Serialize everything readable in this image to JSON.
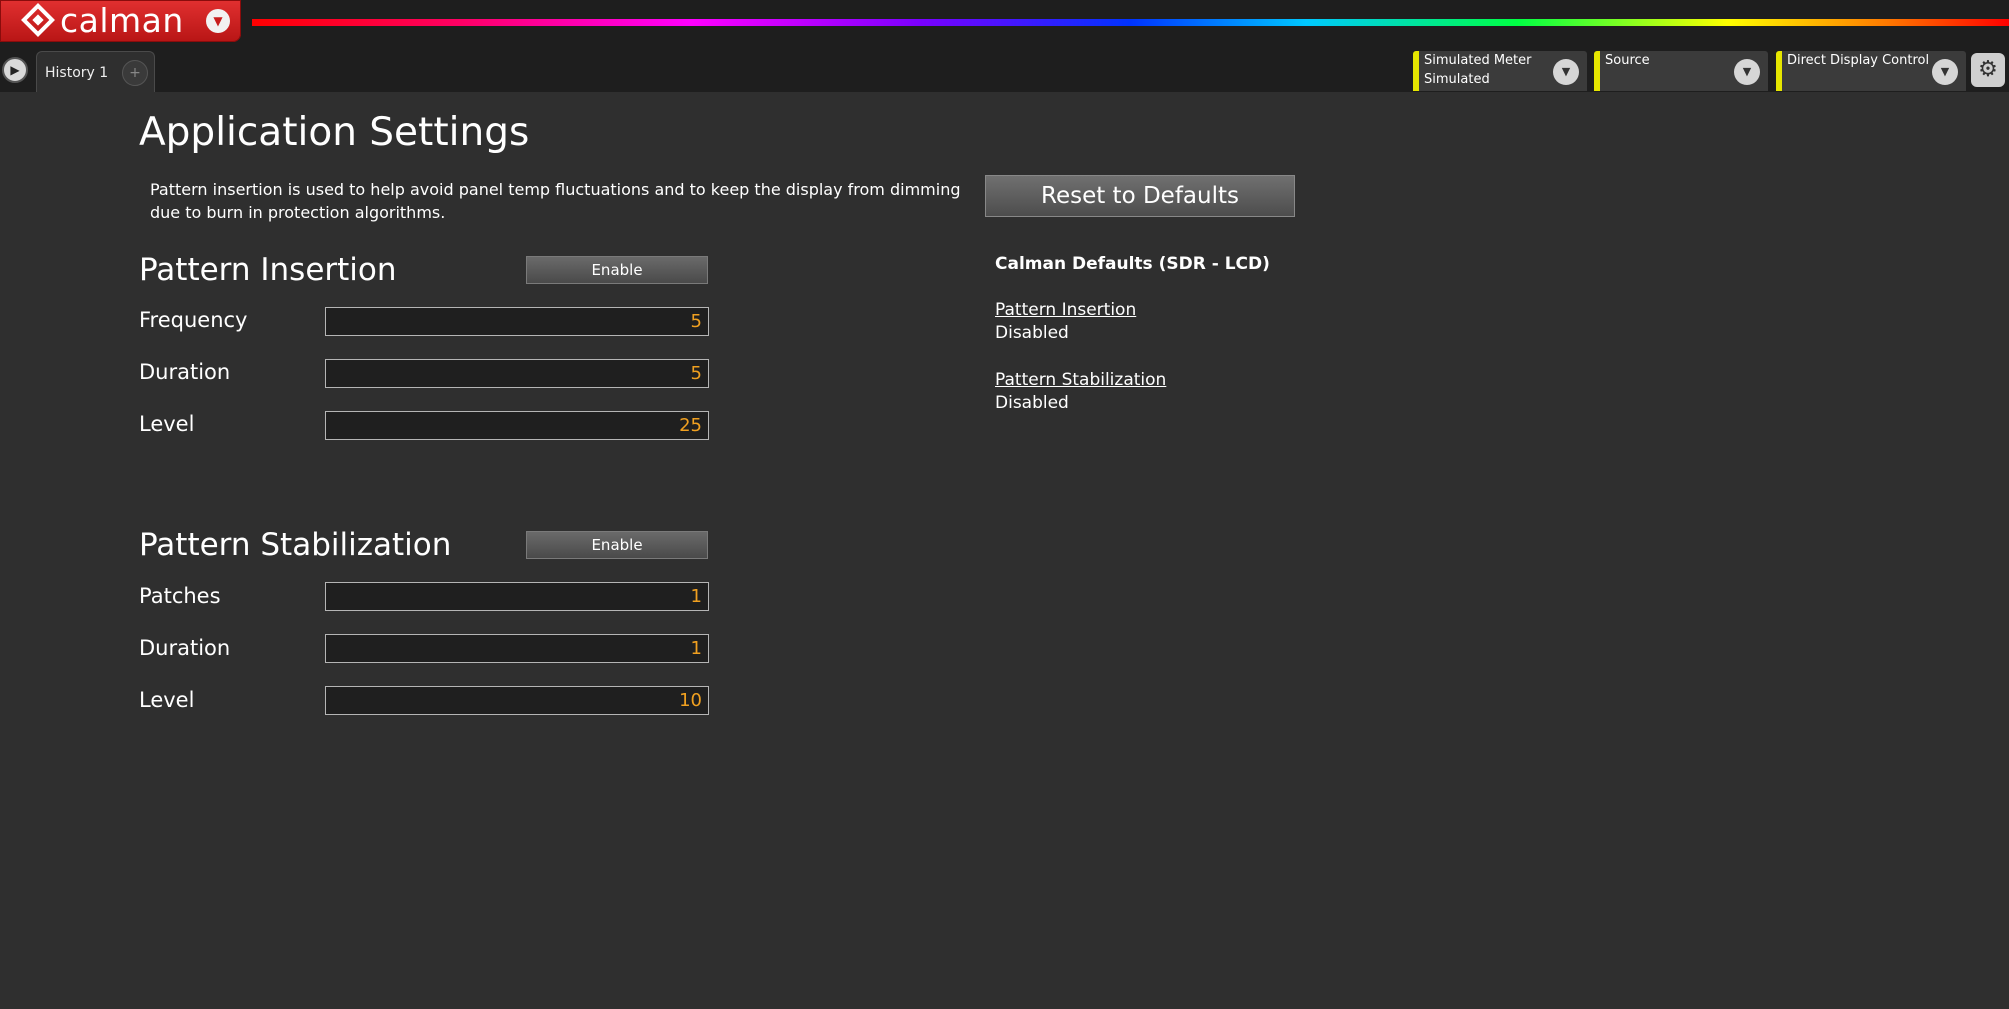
{
  "app": {
    "logo_text": "calman",
    "colors": {
      "brand_red": "#d42020",
      "accent_yellow": "#e6e600",
      "value_orange": "#f0a020",
      "background": "#2f2f2f"
    }
  },
  "tabs": [
    {
      "label": "History 1"
    }
  ],
  "toolbar": {
    "devices": [
      {
        "line1": "Simulated Meter",
        "line2": "Simulated",
        "icon": "chevron-down-icon"
      },
      {
        "line1": "Source",
        "line2": "",
        "icon": "chevron-down-icon"
      },
      {
        "line1": "Direct Display Control",
        "line2": "",
        "icon": "chevron-down-icon"
      }
    ],
    "settings_icon": "gear-icon"
  },
  "page": {
    "title": "Application Settings",
    "description": "Pattern insertion is used to help avoid panel temp fluctuations and to keep the display from dimming due to burn in protection algorithms."
  },
  "pattern_insertion": {
    "title": "Pattern Insertion",
    "enable_label": "Enable",
    "fields": [
      {
        "label": "Frequency",
        "value": "5"
      },
      {
        "label": "Duration",
        "value": "5"
      },
      {
        "label": "Level",
        "value": "25"
      }
    ]
  },
  "pattern_stabilization": {
    "title": "Pattern Stabilization",
    "enable_label": "Enable",
    "fields": [
      {
        "label": "Patches",
        "value": "1"
      },
      {
        "label": "Duration",
        "value": "1"
      },
      {
        "label": "Level",
        "value": "10"
      }
    ]
  },
  "defaults": {
    "reset_label": "Reset to Defaults",
    "heading": "Calman Defaults (SDR - LCD)",
    "items": [
      {
        "label": "Pattern Insertion",
        "value": "Disabled"
      },
      {
        "label": "Pattern Stabilization",
        "value": "Disabled"
      }
    ]
  }
}
